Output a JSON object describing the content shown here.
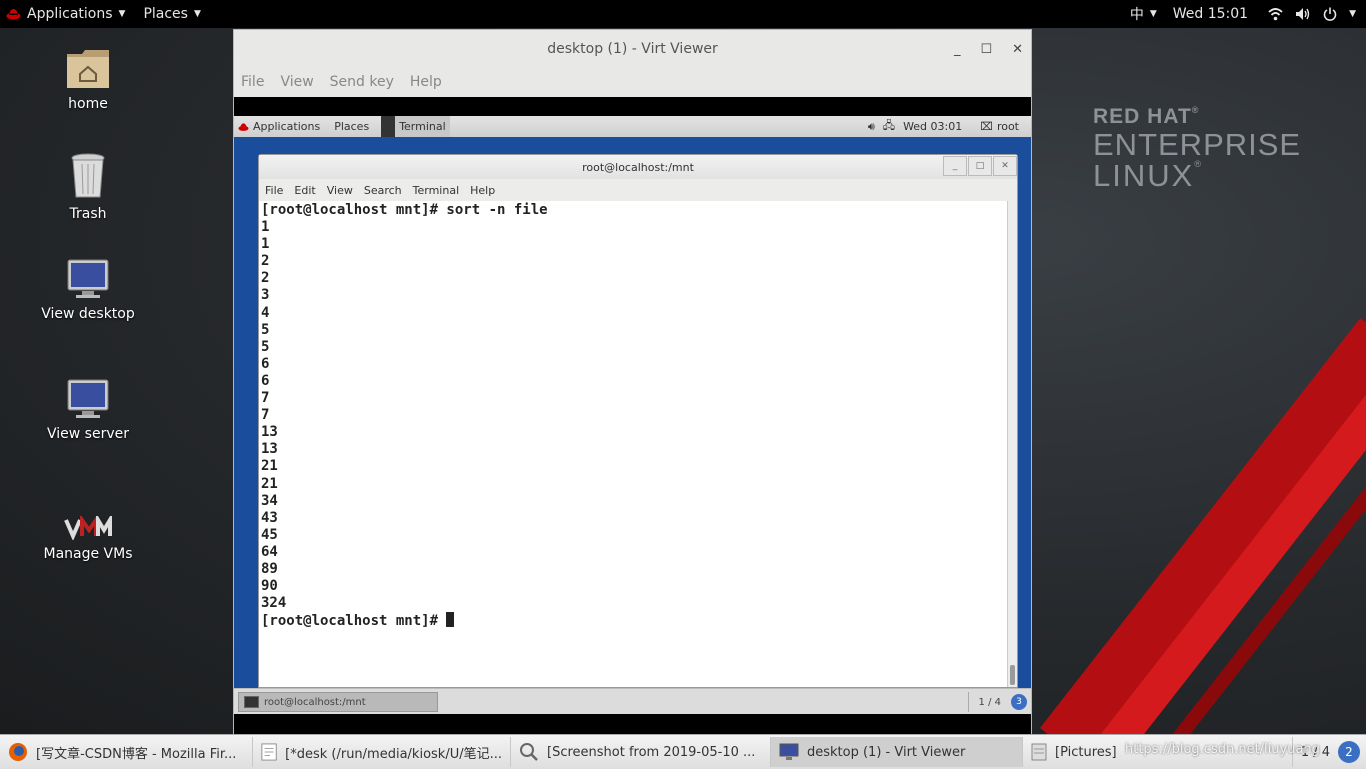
{
  "host_topbar": {
    "applications": "Applications",
    "places": "Places",
    "input_method": "中",
    "clock": "Wed 15:01"
  },
  "desktop_icons": {
    "home": "home",
    "trash": "Trash",
    "view_desktop": "View desktop",
    "view_server": "View server",
    "manage_vms": "Manage VMs"
  },
  "brand": {
    "line1": "RED HAT",
    "line2": "ENTERPRISE",
    "line3": "LINUX",
    "reg": "®"
  },
  "viewer": {
    "title": "desktop (1) - Virt Viewer",
    "menu": [
      "File",
      "View",
      "Send key",
      "Help"
    ]
  },
  "guest": {
    "topbar": {
      "applications": "Applications",
      "places": "Places",
      "terminal": "Terminal",
      "clock": "Wed 03:01",
      "user": "root"
    },
    "terminal": {
      "title": "root@localhost:/mnt",
      "menu": [
        "File",
        "Edit",
        "View",
        "Search",
        "Terminal",
        "Help"
      ],
      "command_line": "[root@localhost mnt]# sort -n file",
      "output": [
        "1",
        "1",
        "2",
        "2",
        "3",
        "4",
        "5",
        "5",
        "6",
        "6",
        "7",
        "7",
        "13",
        "13",
        "21",
        "21",
        "34",
        "43",
        "45",
        "64",
        "89",
        "90",
        "324"
      ],
      "prompt": "[root@localhost mnt]# "
    },
    "taskbar": {
      "item": "root@localhost:/mnt",
      "pager": "1 / 4",
      "notification_count": "3"
    }
  },
  "taskbar": {
    "items": [
      "[写文章-CSDN博客 - Mozilla Fir...",
      "[*desk (/run/media/kiosk/U/笔记...",
      "[Screenshot from 2019-05-10 ...",
      "desktop (1) - Virt Viewer",
      "[Pictures]"
    ],
    "pager": "1 / 4",
    "notification_count": "2"
  },
  "watermark": "https://blog.csdn.net/liuyuang"
}
